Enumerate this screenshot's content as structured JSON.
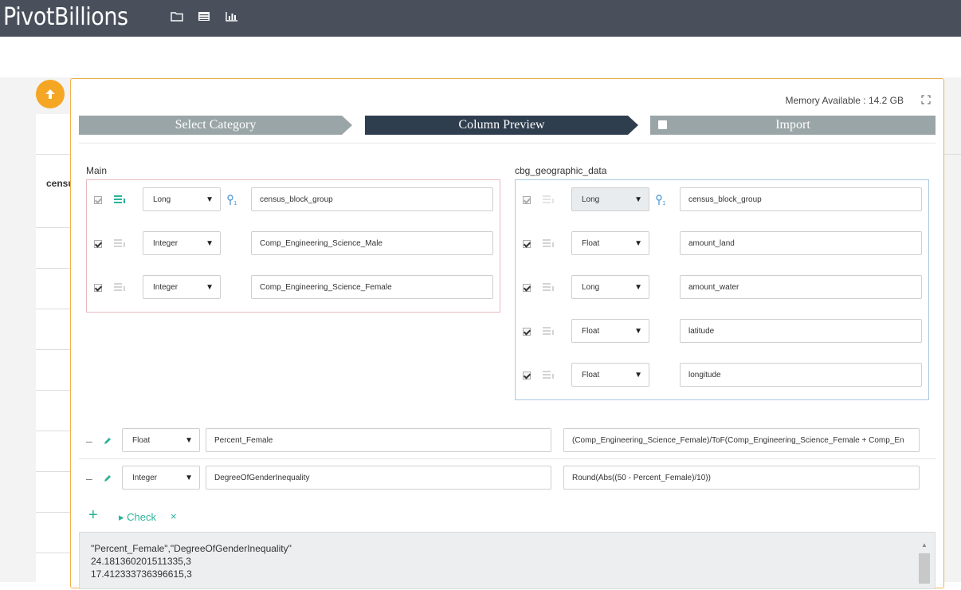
{
  "app": {
    "title": "PivotBillions"
  },
  "toolbar": {
    "icons": [
      "folder-icon",
      "table-icon",
      "bar-chart-icon"
    ]
  },
  "background": {
    "column_label": "censu"
  },
  "wizard": {
    "memory_label": "Memory Available : 14.2 GB",
    "steps": [
      {
        "label": "Select Category",
        "state": "done"
      },
      {
        "label": "Column Preview",
        "state": "active"
      },
      {
        "label": "Import",
        "state": "pending"
      }
    ]
  },
  "main_group": {
    "label": "Main",
    "rows": [
      {
        "checked": true,
        "disabled": true,
        "type": "Long",
        "name": "census_block_group",
        "key": true,
        "active_icon": true
      },
      {
        "checked": true,
        "disabled": false,
        "type": "Integer",
        "name": "Comp_Engineering_Science_Male",
        "key": false,
        "active_icon": false
      },
      {
        "checked": true,
        "disabled": false,
        "type": "Integer",
        "name": "Comp_Engineering_Science_Female",
        "key": false,
        "active_icon": false
      }
    ]
  },
  "cbg_group": {
    "label": "cbg_geographic_data",
    "rows": [
      {
        "checked": true,
        "disabled": true,
        "type": "Long",
        "name": "census_block_group",
        "key": true,
        "grey": true
      },
      {
        "checked": true,
        "disabled": false,
        "type": "Float",
        "name": "amount_land",
        "key": false,
        "grey": false
      },
      {
        "checked": true,
        "disabled": false,
        "type": "Long",
        "name": "amount_water",
        "key": false,
        "grey": false
      },
      {
        "checked": true,
        "disabled": false,
        "type": "Float",
        "name": "latitude",
        "key": false,
        "grey": false
      },
      {
        "checked": true,
        "disabled": false,
        "type": "Float",
        "name": "longitude",
        "key": false,
        "grey": false
      }
    ]
  },
  "computed_columns": [
    {
      "type": "Float",
      "name": "Percent_Female",
      "expression": "(Comp_Engineering_Science_Female)/ToF(Comp_Engineering_Science_Female + Comp_En"
    },
    {
      "type": "Integer",
      "name": "DegreeOfGenderInequality",
      "expression": "Round(Abs((50 - Percent_Female)/10))"
    }
  ],
  "actions": {
    "add": "+",
    "check": "▸ Check",
    "clear": "×"
  },
  "output": {
    "lines": [
      "\"Percent_Female\",\"DegreeOfGenderInequality\"",
      "24.181360201511335,3",
      "17.412333736396615,3"
    ]
  },
  "colors": {
    "accent": "#2bb39a",
    "topbar": "#49505c",
    "step_active": "#2f3e4f",
    "step_inactive": "#9aa5a7",
    "fab": "#f5a623"
  }
}
